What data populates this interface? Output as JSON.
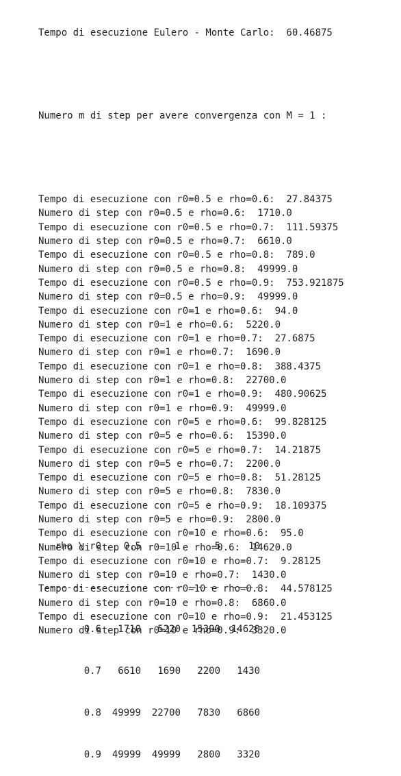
{
  "output": {
    "header_lines": [
      "Tempo di esecuzione Eulero - Monte Carlo:  60.46875",
      "",
      "Numero m di step per avere convergenza con M = 1 :",
      ""
    ],
    "log_lines": [
      "Tempo di esecuzione con r0=0.5 e rho=0.6:  27.84375",
      "Numero di step con r0=0.5 e rho=0.6:  1710.0",
      "Tempo di esecuzione con r0=0.5 e rho=0.7:  111.59375",
      "Numero di step con r0=0.5 e rho=0.7:  6610.0",
      "Tempo di esecuzione con r0=0.5 e rho=0.8:  789.0",
      "Numero di step con r0=0.5 e rho=0.8:  49999.0",
      "Tempo di esecuzione con r0=0.5 e rho=0.9:  753.921875",
      "Numero di step con r0=0.5 e rho=0.9:  49999.0",
      "Tempo di esecuzione con r0=1 e rho=0.6:  94.0",
      "Numero di step con r0=1 e rho=0.6:  5220.0",
      "Tempo di esecuzione con r0=1 e rho=0.7:  27.6875",
      "Numero di step con r0=1 e rho=0.7:  1690.0",
      "Tempo di esecuzione con r0=1 e rho=0.8:  388.4375",
      "Numero di step con r0=1 e rho=0.8:  22700.0",
      "Tempo di esecuzione con r0=1 e rho=0.9:  480.90625",
      "Numero di step con r0=1 e rho=0.9:  49999.0",
      "Tempo di esecuzione con r0=5 e rho=0.6:  99.828125",
      "Numero di step con r0=5 e rho=0.6:  15390.0",
      "Tempo di esecuzione con r0=5 e rho=0.7:  14.21875",
      "Numero di step con r0=5 e rho=0.7:  2200.0",
      "Tempo di esecuzione con r0=5 e rho=0.8:  51.28125",
      "Numero di step con r0=5 e rho=0.8:  7830.0",
      "Tempo di esecuzione con r0=5 e rho=0.9:  18.109375",
      "Numero di step con r0=5 e rho=0.9:  2800.0",
      "Tempo di esecuzione con r0=10 e rho=0.6:  95.0",
      "Numero di step con r0=10 e rho=0.6:  14620.0",
      "Tempo di esecuzione con r0=10 e rho=0.7:  9.28125",
      "Numero di step con r0=10 e rho=0.7:  1430.0",
      "Tempo di esecuzione con r0=10 e rho=0.8:  44.578125",
      "Numero di step con r0=10 e rho=0.8:  6860.0",
      "Tempo di esecuzione con r0=10 e rho=0.9:  21.453125",
      "Numero di step con r0=10 e rho=0.9:  3320.0"
    ],
    "table": {
      "header": [
        "rho \\ r0",
        "0.5",
        "1",
        "5",
        "10"
      ],
      "separator": [
        "----------",
        "-----",
        "-----",
        "-----",
        "-----"
      ],
      "rows": [
        [
          "0.6",
          "1710",
          "5220",
          "15390",
          "14620"
        ],
        [
          "0.7",
          "6610",
          "1690",
          "2200",
          "1430"
        ],
        [
          "0.8",
          "49999",
          "22700",
          "7830",
          "6860"
        ],
        [
          "0.9",
          "49999",
          "49999",
          "2800",
          "3320"
        ]
      ]
    }
  }
}
